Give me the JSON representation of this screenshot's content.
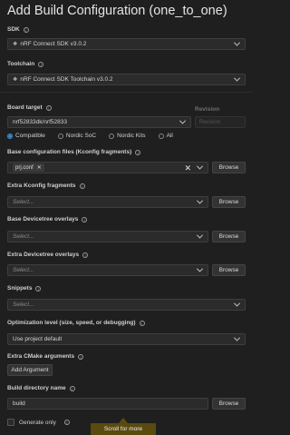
{
  "title": "Add Build Configuration (one_to_one)",
  "sdk": {
    "label": "SDK",
    "value": "nRF Connect SDK v3.0.2"
  },
  "toolchain": {
    "label": "Toolchain",
    "value": "nRF Connect SDK Toolchain v3.0.2"
  },
  "board": {
    "label": "Board target",
    "value": "nrf52833dk/nrf52833",
    "revision_label": "Revision",
    "revision_placeholder": "Revision",
    "filters": [
      "Compatible",
      "Nordic SoC",
      "Nordic Kits",
      "All"
    ],
    "selected_filter": "Compatible"
  },
  "base_conf": {
    "label": "Base configuration files (Kconfig fragments)",
    "chip": "prj.conf",
    "browse": "Browse"
  },
  "extra_kconfig": {
    "label": "Extra Kconfig fragments",
    "placeholder": "Select...",
    "browse": "Browse"
  },
  "base_dt": {
    "label": "Base Devicetree overlays",
    "placeholder": "Select...",
    "browse": "Browse"
  },
  "extra_dt": {
    "label": "Extra Devicetree overlays",
    "placeholder": "Select...",
    "browse": "Browse"
  },
  "snippets": {
    "label": "Snippets",
    "placeholder": "Select..."
  },
  "optimization": {
    "label": "Optimization level (size, speed, or debugging)",
    "value": "Use project default"
  },
  "cmake": {
    "label": "Extra CMake arguments",
    "button": "Add Argument"
  },
  "build_dir": {
    "label": "Build directory name",
    "value": "build",
    "browse": "Browse"
  },
  "generate_only": {
    "label": "Generate only"
  },
  "scroll_more": "Scroll for more",
  "colors": {
    "accent": "#3d8fd6",
    "scroll_bg": "#5a4a10",
    "background": "#1f1f1f"
  }
}
